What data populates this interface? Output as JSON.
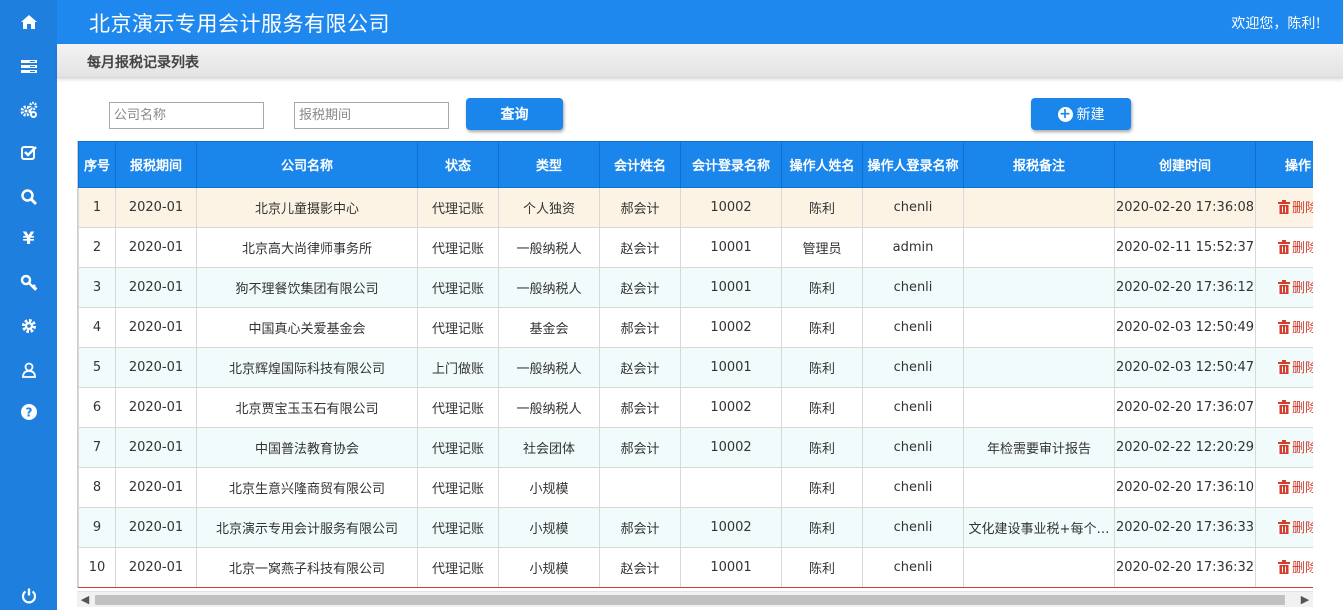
{
  "header": {
    "company_title": "北京演示专用会计服务有限公司",
    "welcome": "欢迎您，陈利!"
  },
  "page": {
    "title": "每月报税记录列表"
  },
  "sidebar": {
    "icons": [
      "home-icon",
      "list-icon",
      "gears-icon",
      "checkbox-icon",
      "search-icon",
      "yen-icon",
      "key-icon",
      "cog-icon",
      "user-icon",
      "help-icon",
      "power-icon"
    ]
  },
  "search": {
    "company_placeholder": "公司名称",
    "period_placeholder": "报税期间",
    "query_label": "查询",
    "new_label": "新建"
  },
  "colors": {
    "sidebar": "#1e7fde",
    "header": "#1e88ee",
    "accent": "#1a86ec",
    "delete": "#d43c2c"
  },
  "table": {
    "columns": [
      "序号",
      "报税期间",
      "公司名称",
      "状态",
      "类型",
      "会计姓名",
      "会计登录名称",
      "操作人姓名",
      "操作人登录名称",
      "报税备注",
      "创建时间",
      "操作"
    ],
    "delete_label": "删除",
    "rows": [
      {
        "no": "1",
        "period": "2020-01",
        "company": "北京儿童摄影中心",
        "status": "代理记账",
        "type": "个人独资",
        "accountant": "郝会计",
        "acc_login": "10002",
        "operator": "陈利",
        "op_login": "chenli",
        "remark": "",
        "created": "2020-02-20 17:36:08"
      },
      {
        "no": "2",
        "period": "2020-01",
        "company": "北京高大尚律师事务所",
        "status": "代理记账",
        "type": "一般纳税人",
        "accountant": "赵会计",
        "acc_login": "10001",
        "operator": "管理员",
        "op_login": "admin",
        "remark": "",
        "created": "2020-02-11 15:52:37"
      },
      {
        "no": "3",
        "period": "2020-01",
        "company": "狗不理餐饮集团有限公司",
        "status": "代理记账",
        "type": "一般纳税人",
        "accountant": "赵会计",
        "acc_login": "10001",
        "operator": "陈利",
        "op_login": "chenli",
        "remark": "",
        "created": "2020-02-20 17:36:12"
      },
      {
        "no": "4",
        "period": "2020-01",
        "company": "中国真心关爱基金会",
        "status": "代理记账",
        "type": "基金会",
        "accountant": "郝会计",
        "acc_login": "10002",
        "operator": "陈利",
        "op_login": "chenli",
        "remark": "",
        "created": "2020-02-03 12:50:49"
      },
      {
        "no": "5",
        "period": "2020-01",
        "company": "北京辉煌国际科技有限公司",
        "status": "上门做账",
        "type": "一般纳税人",
        "accountant": "赵会计",
        "acc_login": "10001",
        "operator": "陈利",
        "op_login": "chenli",
        "remark": "",
        "created": "2020-02-03 12:50:47"
      },
      {
        "no": "6",
        "period": "2020-01",
        "company": "北京贾宝玉玉石有限公司",
        "status": "代理记账",
        "type": "一般纳税人",
        "accountant": "郝会计",
        "acc_login": "10002",
        "operator": "陈利",
        "op_login": "chenli",
        "remark": "",
        "created": "2020-02-20 17:36:07"
      },
      {
        "no": "7",
        "period": "2020-01",
        "company": "中国普法教育协会",
        "status": "代理记账",
        "type": "社会团体",
        "accountant": "郝会计",
        "acc_login": "10002",
        "operator": "陈利",
        "op_login": "chenli",
        "remark": "年检需要审计报告",
        "created": "2020-02-22 12:20:29"
      },
      {
        "no": "8",
        "period": "2020-01",
        "company": "北京生意兴隆商贸有限公司",
        "status": "代理记账",
        "type": "小规模",
        "accountant": "",
        "acc_login": "",
        "operator": "陈利",
        "op_login": "chenli",
        "remark": "",
        "created": "2020-02-20 17:36:10"
      },
      {
        "no": "9",
        "period": "2020-01",
        "company": "北京演示专用会计服务有限公司",
        "status": "代理记账",
        "type": "小规模",
        "accountant": "郝会计",
        "acc_login": "10002",
        "operator": "陈利",
        "op_login": "chenli",
        "remark": "文化建设事业税+每个…",
        "created": "2020-02-20 17:36:33"
      },
      {
        "no": "10",
        "period": "2020-01",
        "company": "北京一窝燕子科技有限公司",
        "status": "代理记账",
        "type": "小规模",
        "accountant": "赵会计",
        "acc_login": "10001",
        "operator": "陈利",
        "op_login": "chenli",
        "remark": "",
        "created": "2020-02-20 17:36:32"
      }
    ]
  }
}
